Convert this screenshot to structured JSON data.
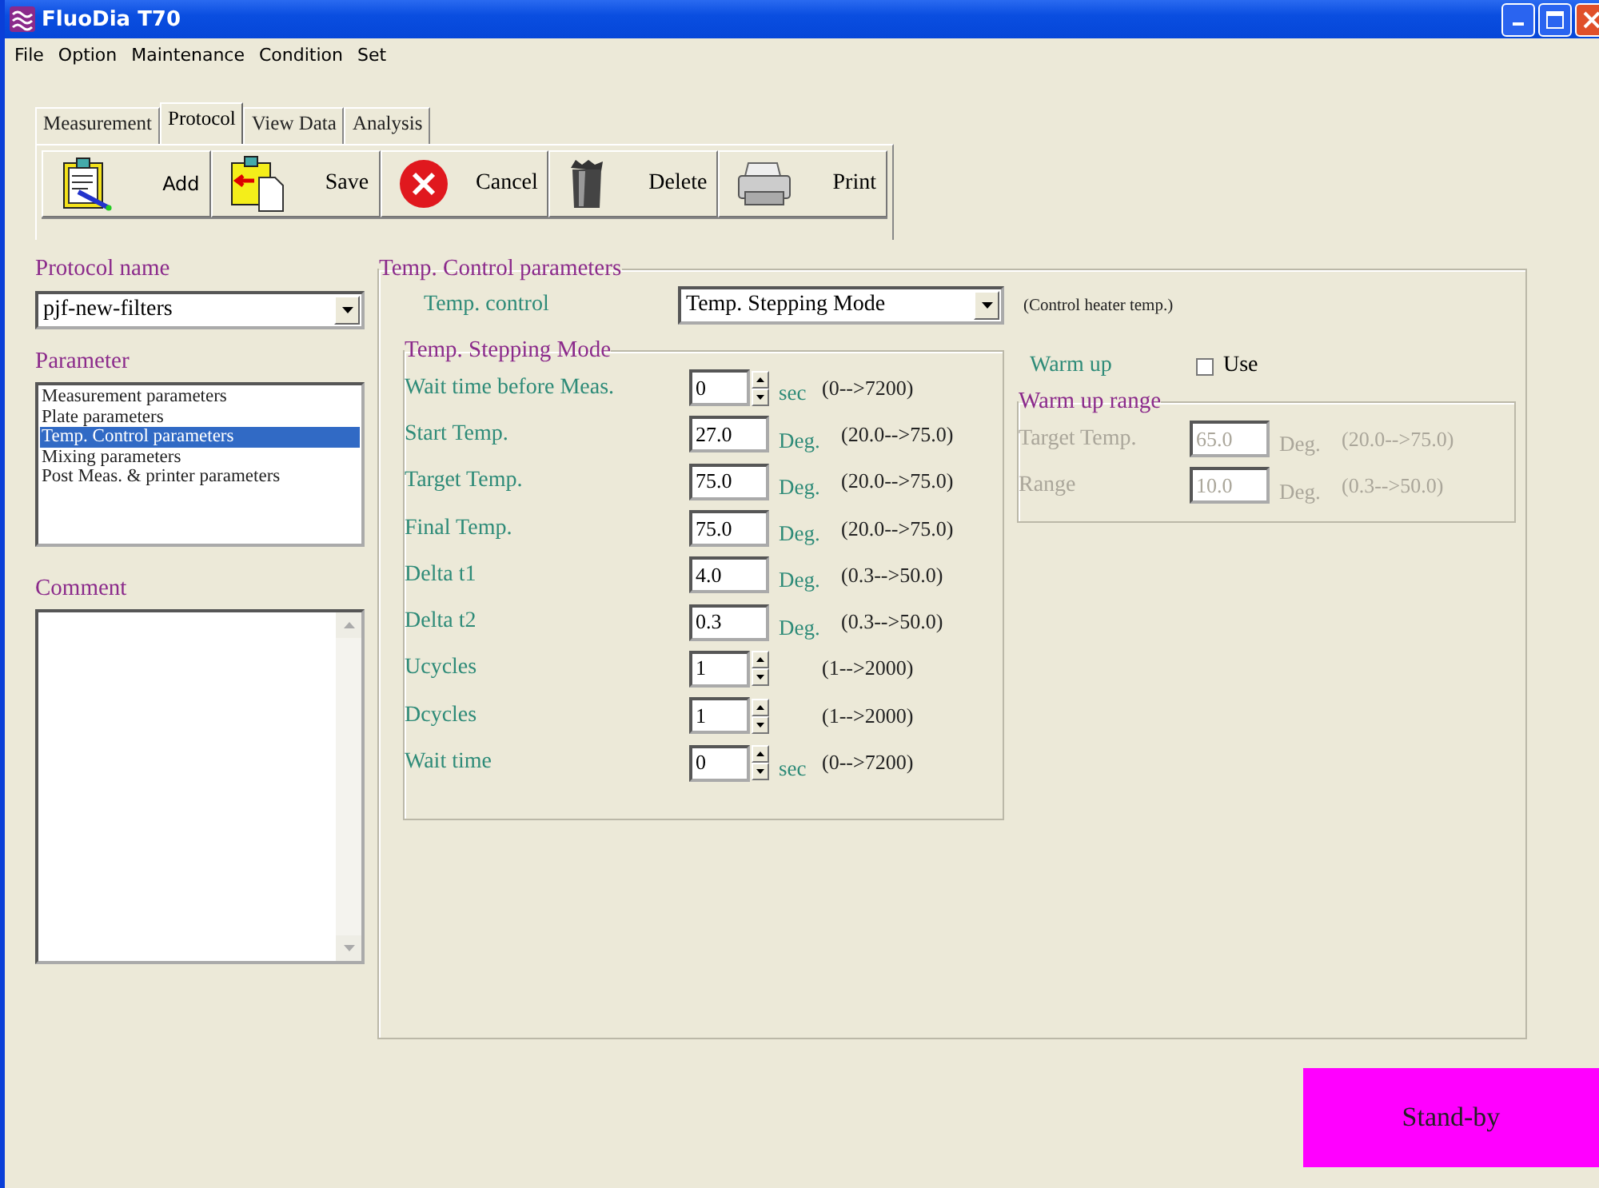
{
  "window": {
    "title": "FluoDia T70"
  },
  "menu": [
    "File",
    "Option",
    "Maintenance",
    "Condition",
    "Set"
  ],
  "tabs": [
    {
      "label": "Measurement",
      "selected": false
    },
    {
      "label": "Protocol",
      "selected": true
    },
    {
      "label": "View Data",
      "selected": false
    },
    {
      "label": "Analysis",
      "selected": false
    }
  ],
  "toolbar": [
    {
      "kind": "add",
      "label": "Add"
    },
    {
      "kind": "save",
      "label": "Save"
    },
    {
      "kind": "cancel",
      "label": "Cancel"
    },
    {
      "kind": "delete",
      "label": "Delete"
    },
    {
      "kind": "print",
      "label": "Print"
    }
  ],
  "protocol_name": {
    "label": "Protocol name",
    "value": "pjf-new-filters"
  },
  "parameter": {
    "label": "Parameter",
    "items": [
      {
        "label": "Measurement parameters",
        "selected": false
      },
      {
        "label": "Plate parameters",
        "selected": false
      },
      {
        "label": "Temp. Control parameters",
        "selected": true
      },
      {
        "label": "Mixing parameters",
        "selected": false
      },
      {
        "label": "Post Meas. & printer parameters",
        "selected": false
      }
    ]
  },
  "comment": {
    "label": "Comment"
  },
  "temp_control": {
    "title": "Temp. Control parameters",
    "label": "Temp. control",
    "value": "Temp. Stepping Mode",
    "note": "(Control heater temp.)",
    "stepping": {
      "title": "Temp. Stepping Mode",
      "rows": [
        {
          "kind": "spin",
          "label": "Wait time before Meas.",
          "value": "0",
          "unit": "sec",
          "range": "(0-->7200)"
        },
        {
          "kind": "text",
          "label": "Start Temp.",
          "value": "27.0",
          "unit": "Deg.",
          "range": "(20.0-->75.0)"
        },
        {
          "kind": "text",
          "label": "Target Temp.",
          "value": "75.0",
          "unit": "Deg.",
          "range": "(20.0-->75.0)"
        },
        {
          "kind": "text",
          "label": "Final Temp.",
          "value": "75.0",
          "unit": "Deg.",
          "range": "(20.0-->75.0)"
        },
        {
          "kind": "text",
          "label": "Delta t1",
          "value": "4.0",
          "unit": "Deg.",
          "range": "(0.3-->50.0)"
        },
        {
          "kind": "text",
          "label": "Delta t2",
          "value": "0.3",
          "unit": "Deg.",
          "range": "(0.3-->50.0)"
        },
        {
          "kind": "spin",
          "label": "Ucycles",
          "value": "1",
          "range": "(1-->2000)"
        },
        {
          "kind": "spin",
          "label": "Dcycles",
          "value": "1",
          "range": "(1-->2000)"
        },
        {
          "kind": "spin",
          "label": "Wait time",
          "value": "0",
          "unit": "sec",
          "range": "(0-->7200)"
        }
      ]
    },
    "warm_up": {
      "label": "Warm up",
      "checkbox": "Use",
      "checked": false,
      "range": {
        "title": "Warm up range",
        "disabled": true,
        "rows": [
          {
            "label": "Target Temp.",
            "value": "65.0",
            "unit": "Deg.",
            "range": "(20.0-->75.0)"
          },
          {
            "label": "Range",
            "value": "10.0",
            "unit": "Deg.",
            "range": "(0.3-->50.0)"
          }
        ]
      }
    }
  },
  "status": {
    "text": "Stand-by"
  }
}
